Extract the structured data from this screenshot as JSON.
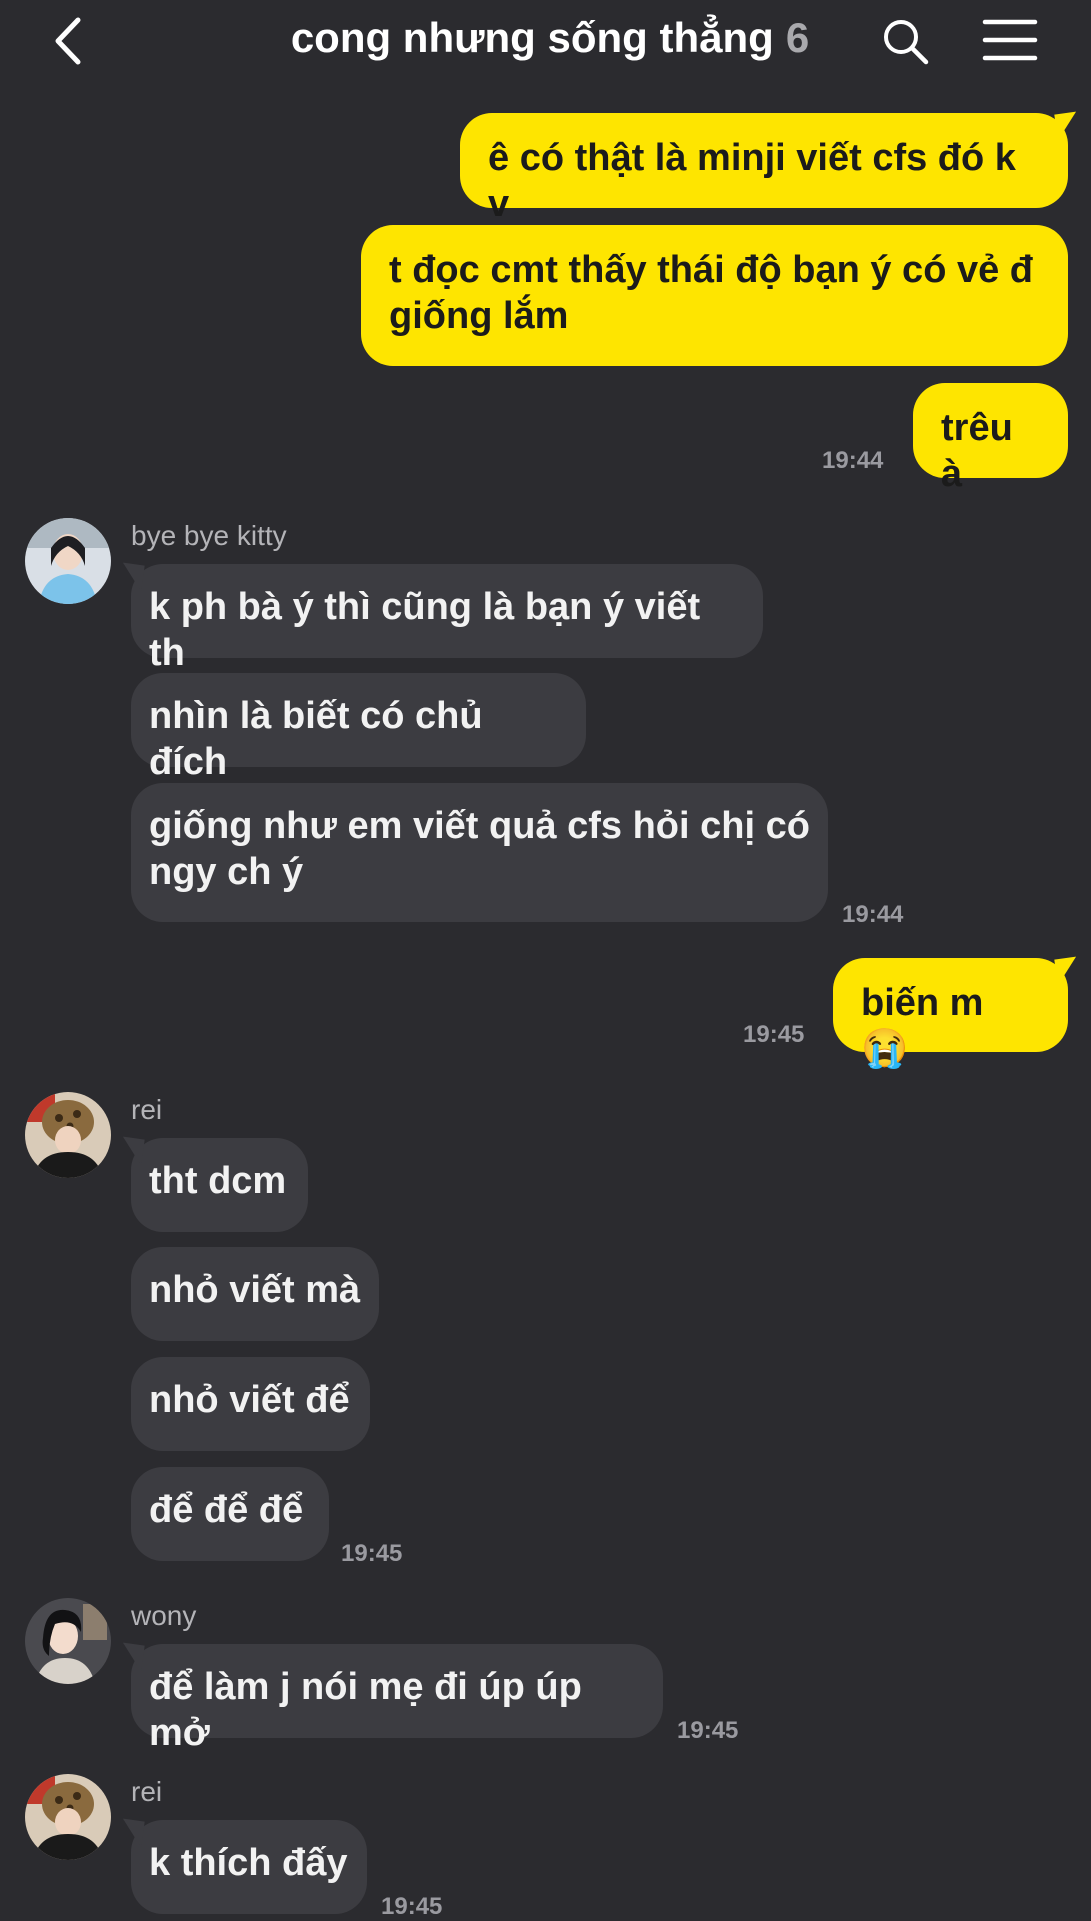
{
  "header": {
    "title": "cong nhưng sống thẳng",
    "member_count": "6",
    "back_icon": "chevron-left-icon",
    "search_icon": "search-icon",
    "menu_icon": "hamburger-menu-icon"
  },
  "colors": {
    "background": "#2b2b2f",
    "outgoing_bubble": "#fee500",
    "incoming_bubble": "#3c3c41"
  },
  "messages": {
    "m1": "ê có thật là minji viết cfs đó k v",
    "m2_line1": "t đọc cmt thấy thái độ bạn ý có vẻ đ",
    "m2_line2": "giống lắm",
    "m3": "trêu à",
    "m3_time": "19:44",
    "s1_name": "bye bye kitty",
    "m4": "k ph bà ý thì cũng là bạn ý viết th",
    "m5": "nhìn là biết có chủ đích",
    "m6_line1": "giống như em viết quả cfs hỏi chị có",
    "m6_line2": "ngy ch ý",
    "m6_time": "19:44",
    "m7": "biến m 😭",
    "m7_time": "19:45",
    "s2_name": "rei",
    "m8": "tht dcm",
    "m9": "nhỏ viết mà",
    "m10": "nhỏ viết để",
    "m11": "để để để",
    "m11_time": "19:45",
    "s3_name": "wony",
    "m12": "để làm j nói mẹ đi úp úp mở",
    "m12_time": "19:45",
    "s4_name": "rei",
    "m13": "k thích đấy",
    "m13_time": "19:45"
  }
}
